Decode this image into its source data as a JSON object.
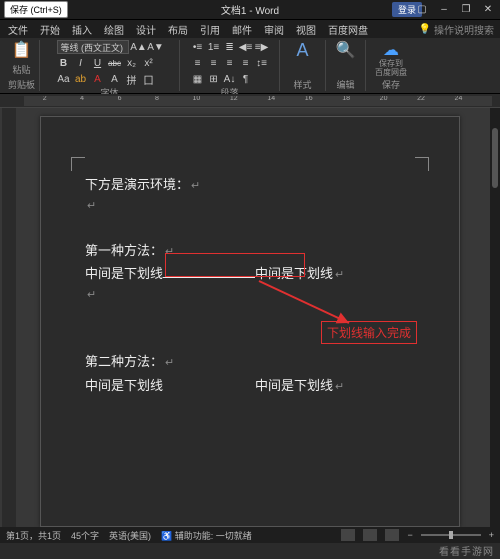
{
  "titlebar": {
    "save_label": "保存 (Ctrl+S)",
    "title": "文档1 - Word",
    "login": "登录",
    "minimize": "–",
    "restore": "❐",
    "close": "✕",
    "ribbon_opts": "▢"
  },
  "tabs": {
    "file": "文件",
    "home": "开始",
    "insert": "插入",
    "draw": "绘图",
    "design": "设计",
    "layout": "布局",
    "references": "引用",
    "mailings": "邮件",
    "review": "审阅",
    "view": "视图",
    "baidu": "百度网盘",
    "search_hint": "操作说明搜索"
  },
  "ribbon": {
    "clipboard": {
      "label": "剪贴板",
      "paste": "粘贴"
    },
    "font": {
      "label": "字体",
      "name": "等线 (西文正文)",
      "bold": "B",
      "italic": "I",
      "underline": "U",
      "strike": "abc",
      "sub": "x₂",
      "sup": "x²",
      "aa_small": "Aa",
      "clear": "A",
      "color": "A",
      "highlight": "ab"
    },
    "paragraph": {
      "label": "段落"
    },
    "styles": {
      "label": "样式"
    },
    "editing": {
      "label": "编辑",
      "find_icon": "🔍"
    },
    "save_to_baidu": {
      "label": "保存",
      "line2": "保存到",
      "line3": "百度网盘"
    }
  },
  "ruler": {
    "nums": [
      "2",
      "4",
      "6",
      "8",
      "10",
      "12",
      "14",
      "16",
      "18",
      "20",
      "22",
      "24"
    ]
  },
  "document": {
    "line1": "下方是演示环境：",
    "method1_title": "第一种方法：",
    "underline_text_left": "中间是下划线",
    "underline_text_right": "中间是下划线",
    "method2_title": "第二种方法：",
    "plain_text_left": "中间是下划线",
    "plain_text_right": "中间是下划线",
    "para_mark": "↵"
  },
  "annotation": {
    "label": "下划线输入完成"
  },
  "statusbar": {
    "page": "第1页，共1页",
    "words": "45个字",
    "lang": "英语(美国)",
    "accessibility": "辅助功能: 一切就绪",
    "zoom": "+"
  },
  "watermark": "看看手游网"
}
